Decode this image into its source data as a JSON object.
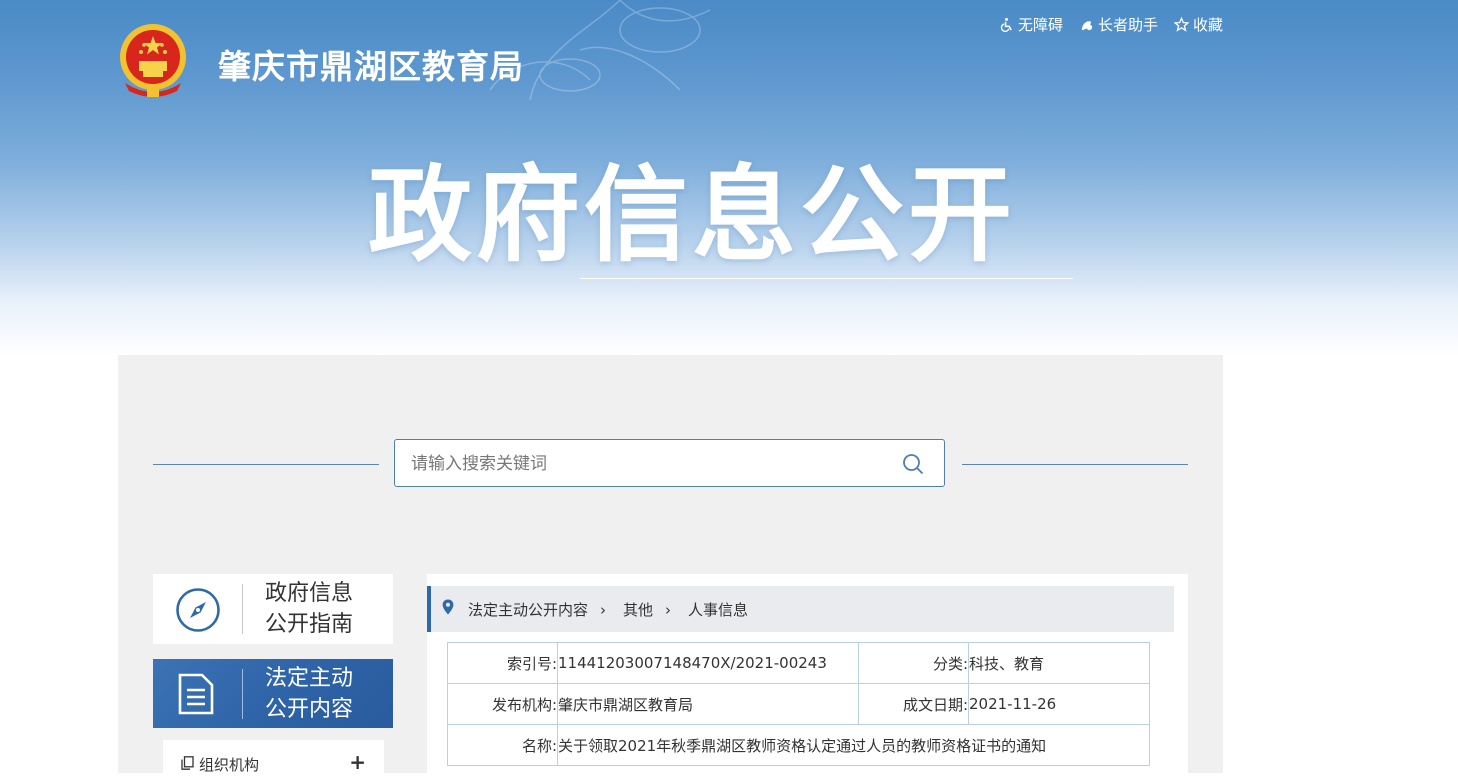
{
  "header": {
    "site_title": "肇庆市鼎湖区教育局",
    "banner_title": "政府信息公开",
    "links": [
      {
        "icon": "wheelchair-icon",
        "label": "无障碍"
      },
      {
        "icon": "elder-assistant-icon",
        "label": "长者助手"
      },
      {
        "icon": "star-icon",
        "label": "收藏"
      }
    ]
  },
  "search": {
    "placeholder": "请输入搜索关键词"
  },
  "sidebar": {
    "guide": {
      "line1": "政府信息",
      "line2": "公开指南",
      "icon": "compass-icon"
    },
    "active": {
      "line1": "法定主动",
      "line2": "公开内容",
      "icon": "document-icon"
    },
    "submenu": [
      {
        "label": "组织机构",
        "toggle": "+"
      }
    ]
  },
  "breadcrumb": [
    "法定主动公开内容",
    "其他",
    "人事信息"
  ],
  "info": {
    "index_label": "索引号:",
    "index_value": "11441203007148470X/2021-00243",
    "category_label": "分类:",
    "category_value": "科技、教育",
    "publisher_label": "发布机构:",
    "publisher_value": "肇庆市鼎湖区教育局",
    "date_label": "成文日期:",
    "date_value": "2021-11-26",
    "name_label": "名称:",
    "name_value": "关于领取2021年秋季鼎湖区教师资格认定通过人员的教师资格证书的通知"
  },
  "colors": {
    "primary": "#2f6aa8",
    "banner_top": "#4a8ac6",
    "main_bg": "#f0f0f0",
    "table_border": "#b9cfe3"
  }
}
